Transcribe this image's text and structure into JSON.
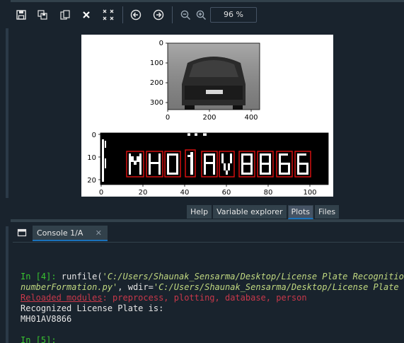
{
  "toolbar": {
    "zoom_value": "96 %"
  },
  "plots": {
    "top_axes": {
      "y_ticks": [
        "0",
        "100",
        "200",
        "300"
      ],
      "x_ticks": [
        "0",
        "200",
        "400"
      ]
    },
    "bottom_axes": {
      "y_ticks": [
        "0",
        "10",
        "20"
      ],
      "x_ticks": [
        "0",
        "20",
        "40",
        "60",
        "80",
        "100"
      ]
    }
  },
  "tabs": [
    {
      "label": "Help"
    },
    {
      "label": "Variable explorer"
    },
    {
      "label": "Plots"
    },
    {
      "label": "Files"
    }
  ],
  "console": {
    "tab_label": "Console 1/A",
    "lines": {
      "prompt1": "In [4]:",
      "cmd_start": " runfile(",
      "path1": "'C:/Users/Shaunak_Sensarma/Desktop/License Plate Recognition/",
      "path1b": "numberFormation.py'",
      "wdir": ", wdir=",
      "path2": "'C:/Users/Shaunak_Sensarma/Desktop/License Plate Rec",
      "reloaded_label": "Reloaded modules",
      "reloaded_list": ": preprocess, plotting, database, person",
      "result_label": "Recognized License Plate is:",
      "result_value": "MH01AV8866",
      "prompt2": "In [5]:"
    }
  }
}
